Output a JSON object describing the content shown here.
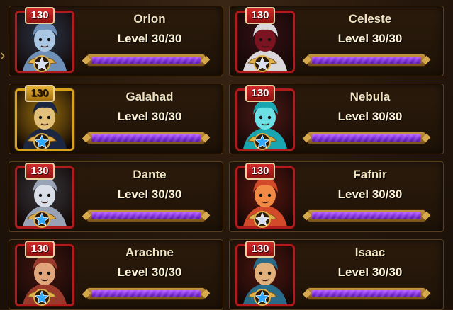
{
  "colors": {
    "frame_red": "#b01b1b",
    "frame_gold": "#d9a21c",
    "bar_purple": "#7b2bd6",
    "text_gold": "#f1e2c0"
  },
  "nav": {
    "left_arrow_icon": "chevron-right-icon"
  },
  "heroes": [
    {
      "name": "Orion",
      "level_badge": "130",
      "level_text": "Level 30/30",
      "progress": 1.0,
      "frame": "red",
      "star": "silver-star"
    },
    {
      "name": "Celeste",
      "level_badge": "130",
      "level_text": "Level 30/30",
      "progress": 1.0,
      "frame": "red",
      "star": "silver-star"
    },
    {
      "name": "Galahad",
      "level_badge": "130",
      "level_text": "Level 30/30",
      "progress": 1.0,
      "frame": "gold",
      "star": "blue-star"
    },
    {
      "name": "Nebula",
      "level_badge": "130",
      "level_text": "Level 30/30",
      "progress": 1.0,
      "frame": "red",
      "star": "blue-star"
    },
    {
      "name": "Dante",
      "level_badge": "130",
      "level_text": "Level 30/30",
      "progress": 1.0,
      "frame": "red",
      "star": "blue-star"
    },
    {
      "name": "Fafnir",
      "level_badge": "130",
      "level_text": "Level 30/30",
      "progress": 1.0,
      "frame": "red",
      "star": "silver-star"
    },
    {
      "name": "Arachne",
      "level_badge": "130",
      "level_text": "Level 30/30",
      "progress": 1.0,
      "frame": "red",
      "star": "blue-star"
    },
    {
      "name": "Isaac",
      "level_badge": "130",
      "level_text": "Level 30/30",
      "progress": 1.0,
      "frame": "red",
      "star": "blue-star"
    }
  ]
}
